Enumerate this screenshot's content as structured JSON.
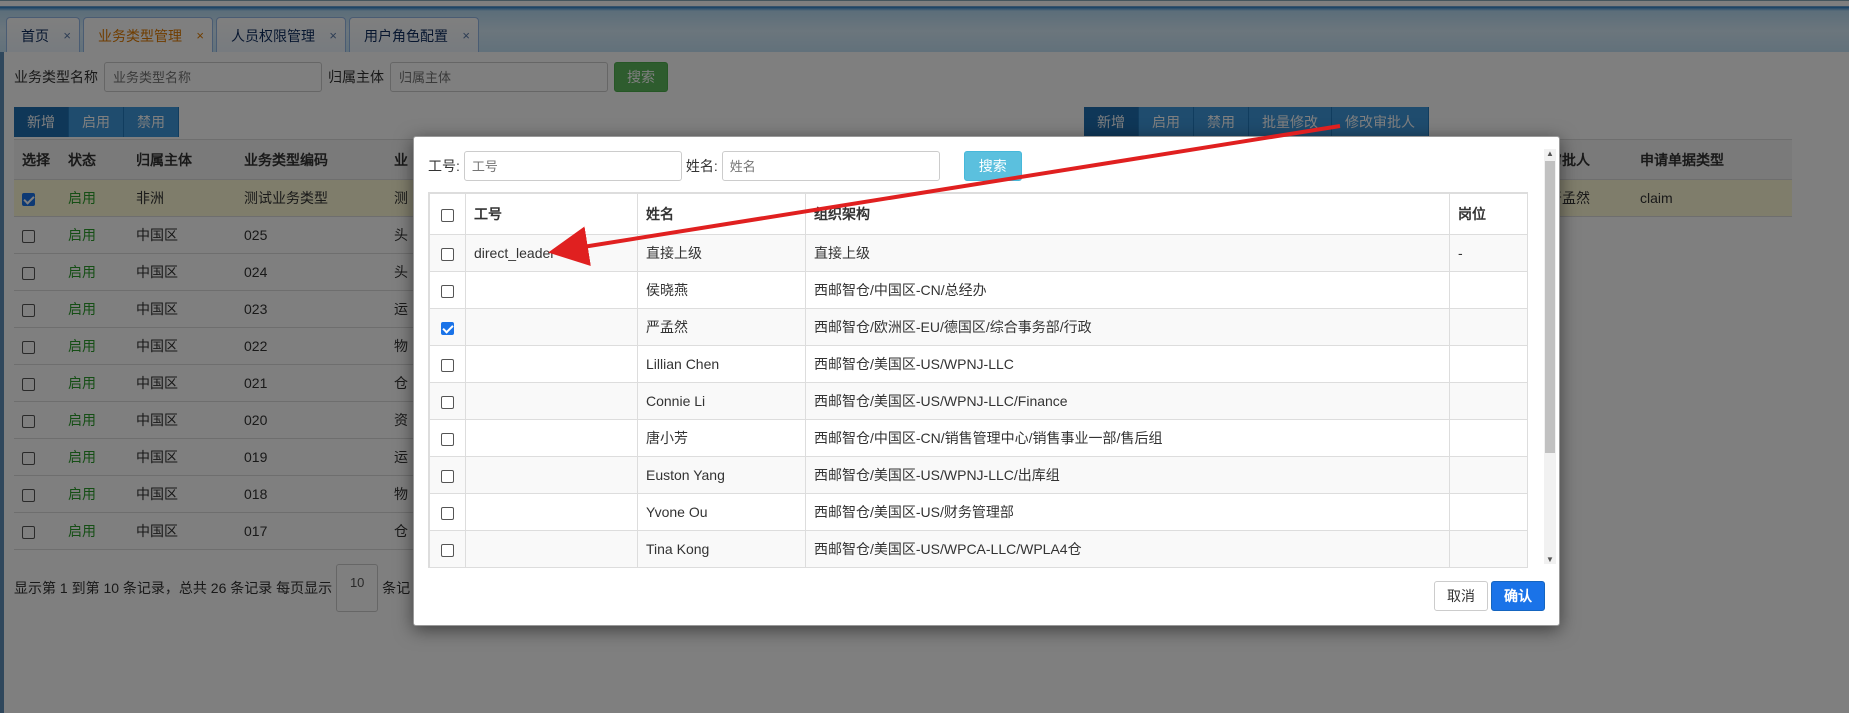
{
  "tabs": [
    {
      "label": "首页",
      "active": false
    },
    {
      "label": "业务类型管理",
      "active": true
    },
    {
      "label": "人员权限管理",
      "active": false
    },
    {
      "label": "用户角色配置",
      "active": false
    }
  ],
  "tab_close": "×",
  "search": {
    "name_label": "业务类型名称",
    "name_placeholder": "业务类型名称",
    "owner_label": "归属主体",
    "owner_placeholder": "归属主体",
    "search_button": "搜索"
  },
  "toolbar_left": [
    "新增",
    "启用",
    "禁用"
  ],
  "toolbar_right": [
    "新增",
    "启用",
    "禁用",
    "批量修改",
    "修改审批人"
  ],
  "table": {
    "headers": [
      "选择",
      "状态",
      "归属主体",
      "业务类型编码",
      "业"
    ],
    "rows": [
      {
        "checked": true,
        "status": "启用",
        "owner": "非洲",
        "code": "测试业务类型",
        "extra": "测"
      },
      {
        "checked": false,
        "status": "启用",
        "owner": "中国区",
        "code": "025",
        "extra": "头"
      },
      {
        "checked": false,
        "status": "启用",
        "owner": "中国区",
        "code": "024",
        "extra": "头"
      },
      {
        "checked": false,
        "status": "启用",
        "owner": "中国区",
        "code": "023",
        "extra": "运"
      },
      {
        "checked": false,
        "status": "启用",
        "owner": "中国区",
        "code": "022",
        "extra": "物"
      },
      {
        "checked": false,
        "status": "启用",
        "owner": "中国区",
        "code": "021",
        "extra": "仓"
      },
      {
        "checked": false,
        "status": "启用",
        "owner": "中国区",
        "code": "020",
        "extra": "资"
      },
      {
        "checked": false,
        "status": "启用",
        "owner": "中国区",
        "code": "019",
        "extra": "运"
      },
      {
        "checked": false,
        "status": "启用",
        "owner": "中国区",
        "code": "018",
        "extra": "物"
      },
      {
        "checked": false,
        "status": "启用",
        "owner": "中国区",
        "code": "017",
        "extra": "仓"
      }
    ]
  },
  "table_right": {
    "headers": [
      "审批人",
      "申请单据类型"
    ],
    "first_row": [
      "严孟然",
      "claim"
    ]
  },
  "pager": {
    "text": "显示第 1 到第 10 条记录，总共 26 条记录 每页显示",
    "page_size": "10",
    "suffix": "条记"
  },
  "modal": {
    "empno_label": "工号:",
    "empno_placeholder": "工号",
    "name_label": "姓名:",
    "name_placeholder": "姓名",
    "search_button": "搜索",
    "headers": [
      "工号",
      "姓名",
      "组织架构",
      "岗位"
    ],
    "rows": [
      {
        "checked": false,
        "empno": "direct_leader",
        "name": "直接上级",
        "org": "直接上级",
        "post": "-"
      },
      {
        "checked": false,
        "empno": "",
        "name": "侯晓燕",
        "org": "西邮智仓/中国区-CN/总经办",
        "post": ""
      },
      {
        "checked": true,
        "empno": "",
        "name": "严孟然",
        "org": "西邮智仓/欧洲区-EU/德国区/综合事务部/行政",
        "post": ""
      },
      {
        "checked": false,
        "empno": "",
        "name": "Lillian Chen",
        "org": "西邮智仓/美国区-US/WPNJ-LLC",
        "post": ""
      },
      {
        "checked": false,
        "empno": "",
        "name": "Connie Li",
        "org": "西邮智仓/美国区-US/WPNJ-LLC/Finance",
        "post": ""
      },
      {
        "checked": false,
        "empno": "",
        "name": "唐小芳",
        "org": "西邮智仓/中国区-CN/销售管理中心/销售事业一部/售后组",
        "post": ""
      },
      {
        "checked": false,
        "empno": "",
        "name": "Euston Yang",
        "org": "西邮智仓/美国区-US/WPNJ-LLC/出库组",
        "post": ""
      },
      {
        "checked": false,
        "empno": "",
        "name": "Yvone Ou",
        "org": "西邮智仓/美国区-US/财务管理部",
        "post": ""
      },
      {
        "checked": false,
        "empno": "",
        "name": "Tina Kong",
        "org": "西邮智仓/美国区-US/WPCA-LLC/WPLA4仓",
        "post": ""
      }
    ],
    "cancel_button": "取消",
    "confirm_button": "确认"
  },
  "colors": {
    "accent": "#1a73e8",
    "status_green": "#2a9d2a",
    "annotation_arrow": "#e02020"
  }
}
